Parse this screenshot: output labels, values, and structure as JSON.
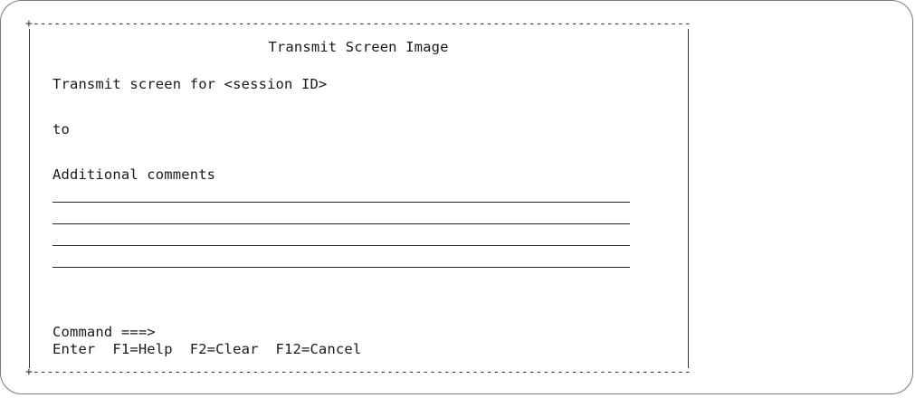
{
  "dialog": {
    "title": "Transmit Screen Image",
    "transmit_label": "Transmit screen for <session ID>",
    "to_label": "to",
    "comments_label": "Additional comments",
    "comment_lines": [
      "",
      "",
      "",
      ""
    ],
    "command_label": "Command ===>",
    "function_keys": "Enter  F1=Help  F2=Clear  F12=Cancel"
  },
  "border": {
    "top": "+-----------------------------------------------------------------------------------------------+",
    "bottom": "+-----------------------------------------------------------------------------------------------+"
  }
}
